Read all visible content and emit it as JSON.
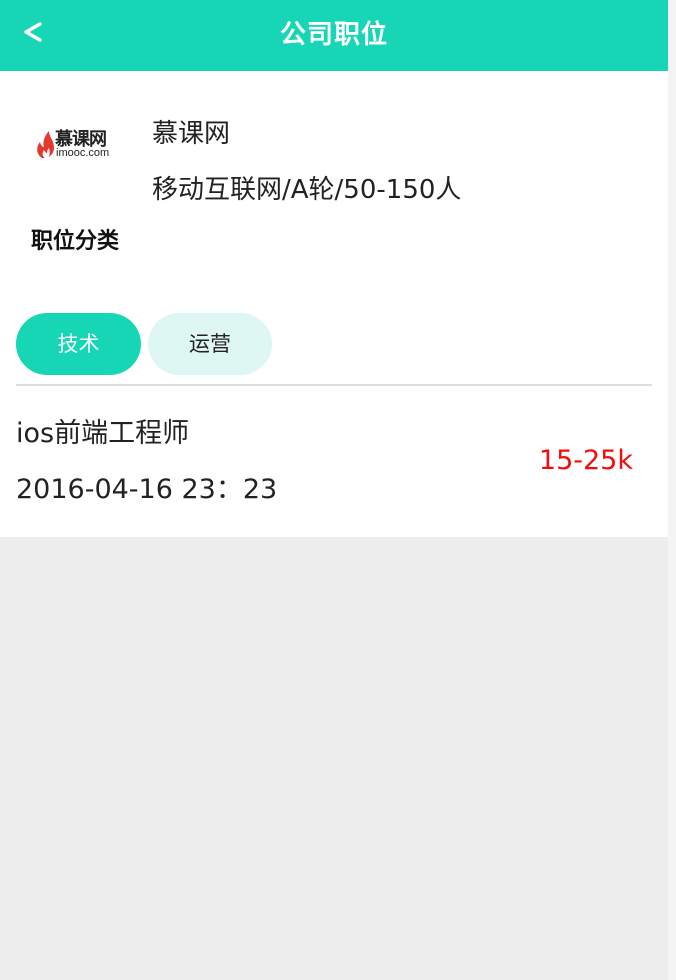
{
  "header": {
    "back_label": "<",
    "title": "公司职位"
  },
  "company": {
    "logo_brand": "慕课网",
    "logo_domain": "imooc.com",
    "name": "慕课网",
    "info": "移动互联网/A轮/50-150人"
  },
  "section": {
    "label": "职位分类"
  },
  "tabs": [
    {
      "label": "技术",
      "active": true
    },
    {
      "label": "运营",
      "active": false
    }
  ],
  "jobs": [
    {
      "title": "ios前端工程师",
      "time": "2016-04-16 23：23",
      "salary": "15-25k"
    }
  ],
  "colors": {
    "accent": "#16d6b6",
    "tab_inactive_bg": "#dff7f3",
    "salary": "#f20d0d",
    "page_bg": "#ededed"
  },
  "icons": {
    "back": "chevron-left-icon",
    "logo_flame": "flame-icon"
  }
}
